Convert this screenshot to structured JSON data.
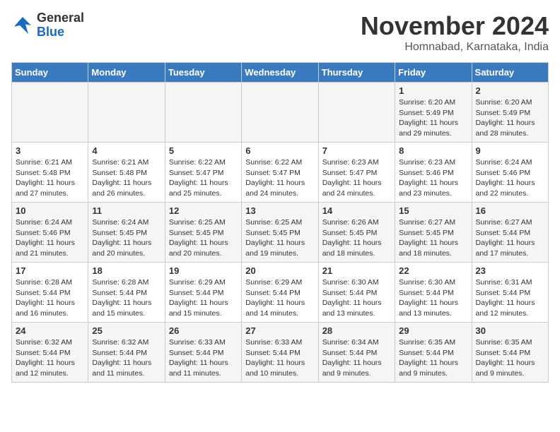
{
  "logo": {
    "general": "General",
    "blue": "Blue"
  },
  "title": "November 2024",
  "subtitle": "Homnabad, Karnataka, India",
  "days_of_week": [
    "Sunday",
    "Monday",
    "Tuesday",
    "Wednesday",
    "Thursday",
    "Friday",
    "Saturday"
  ],
  "weeks": [
    [
      {
        "day": "",
        "info": ""
      },
      {
        "day": "",
        "info": ""
      },
      {
        "day": "",
        "info": ""
      },
      {
        "day": "",
        "info": ""
      },
      {
        "day": "",
        "info": ""
      },
      {
        "day": "1",
        "info": "Sunrise: 6:20 AM\nSunset: 5:49 PM\nDaylight: 11 hours and 29 minutes."
      },
      {
        "day": "2",
        "info": "Sunrise: 6:20 AM\nSunset: 5:49 PM\nDaylight: 11 hours and 28 minutes."
      }
    ],
    [
      {
        "day": "3",
        "info": "Sunrise: 6:21 AM\nSunset: 5:48 PM\nDaylight: 11 hours and 27 minutes."
      },
      {
        "day": "4",
        "info": "Sunrise: 6:21 AM\nSunset: 5:48 PM\nDaylight: 11 hours and 26 minutes."
      },
      {
        "day": "5",
        "info": "Sunrise: 6:22 AM\nSunset: 5:47 PM\nDaylight: 11 hours and 25 minutes."
      },
      {
        "day": "6",
        "info": "Sunrise: 6:22 AM\nSunset: 5:47 PM\nDaylight: 11 hours and 24 minutes."
      },
      {
        "day": "7",
        "info": "Sunrise: 6:23 AM\nSunset: 5:47 PM\nDaylight: 11 hours and 24 minutes."
      },
      {
        "day": "8",
        "info": "Sunrise: 6:23 AM\nSunset: 5:46 PM\nDaylight: 11 hours and 23 minutes."
      },
      {
        "day": "9",
        "info": "Sunrise: 6:24 AM\nSunset: 5:46 PM\nDaylight: 11 hours and 22 minutes."
      }
    ],
    [
      {
        "day": "10",
        "info": "Sunrise: 6:24 AM\nSunset: 5:46 PM\nDaylight: 11 hours and 21 minutes."
      },
      {
        "day": "11",
        "info": "Sunrise: 6:24 AM\nSunset: 5:45 PM\nDaylight: 11 hours and 20 minutes."
      },
      {
        "day": "12",
        "info": "Sunrise: 6:25 AM\nSunset: 5:45 PM\nDaylight: 11 hours and 20 minutes."
      },
      {
        "day": "13",
        "info": "Sunrise: 6:25 AM\nSunset: 5:45 PM\nDaylight: 11 hours and 19 minutes."
      },
      {
        "day": "14",
        "info": "Sunrise: 6:26 AM\nSunset: 5:45 PM\nDaylight: 11 hours and 18 minutes."
      },
      {
        "day": "15",
        "info": "Sunrise: 6:27 AM\nSunset: 5:45 PM\nDaylight: 11 hours and 18 minutes."
      },
      {
        "day": "16",
        "info": "Sunrise: 6:27 AM\nSunset: 5:44 PM\nDaylight: 11 hours and 17 minutes."
      }
    ],
    [
      {
        "day": "17",
        "info": "Sunrise: 6:28 AM\nSunset: 5:44 PM\nDaylight: 11 hours and 16 minutes."
      },
      {
        "day": "18",
        "info": "Sunrise: 6:28 AM\nSunset: 5:44 PM\nDaylight: 11 hours and 15 minutes."
      },
      {
        "day": "19",
        "info": "Sunrise: 6:29 AM\nSunset: 5:44 PM\nDaylight: 11 hours and 15 minutes."
      },
      {
        "day": "20",
        "info": "Sunrise: 6:29 AM\nSunset: 5:44 PM\nDaylight: 11 hours and 14 minutes."
      },
      {
        "day": "21",
        "info": "Sunrise: 6:30 AM\nSunset: 5:44 PM\nDaylight: 11 hours and 13 minutes."
      },
      {
        "day": "22",
        "info": "Sunrise: 6:30 AM\nSunset: 5:44 PM\nDaylight: 11 hours and 13 minutes."
      },
      {
        "day": "23",
        "info": "Sunrise: 6:31 AM\nSunset: 5:44 PM\nDaylight: 11 hours and 12 minutes."
      }
    ],
    [
      {
        "day": "24",
        "info": "Sunrise: 6:32 AM\nSunset: 5:44 PM\nDaylight: 11 hours and 12 minutes."
      },
      {
        "day": "25",
        "info": "Sunrise: 6:32 AM\nSunset: 5:44 PM\nDaylight: 11 hours and 11 minutes."
      },
      {
        "day": "26",
        "info": "Sunrise: 6:33 AM\nSunset: 5:44 PM\nDaylight: 11 hours and 11 minutes."
      },
      {
        "day": "27",
        "info": "Sunrise: 6:33 AM\nSunset: 5:44 PM\nDaylight: 11 hours and 10 minutes."
      },
      {
        "day": "28",
        "info": "Sunrise: 6:34 AM\nSunset: 5:44 PM\nDaylight: 11 hours and 9 minutes."
      },
      {
        "day": "29",
        "info": "Sunrise: 6:35 AM\nSunset: 5:44 PM\nDaylight: 11 hours and 9 minutes."
      },
      {
        "day": "30",
        "info": "Sunrise: 6:35 AM\nSunset: 5:44 PM\nDaylight: 11 hours and 9 minutes."
      }
    ]
  ]
}
